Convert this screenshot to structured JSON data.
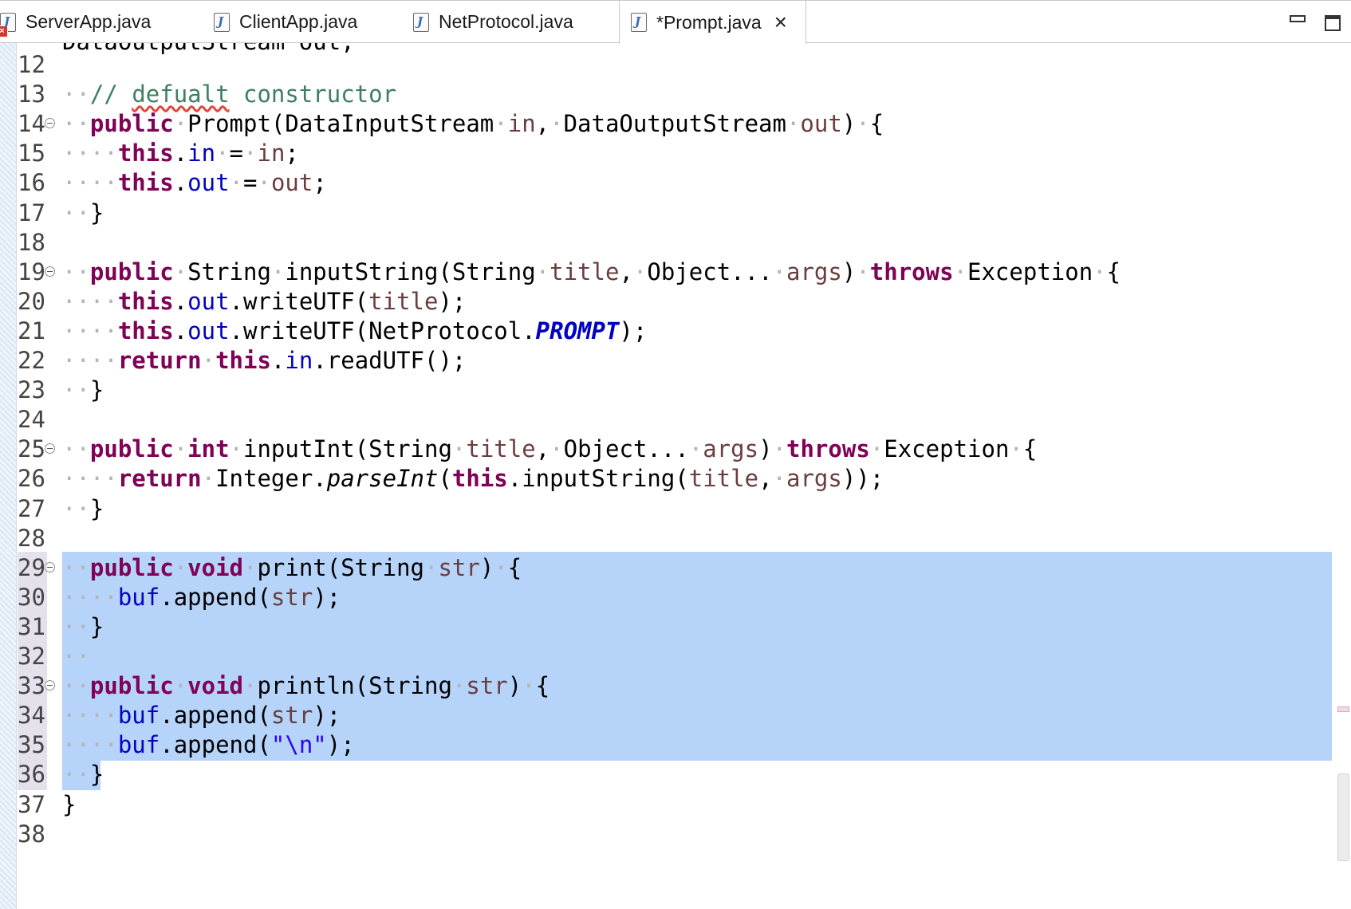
{
  "tabs": [
    {
      "label": "ServerApp.java",
      "icon": "java-file-icon",
      "has_error": true,
      "active": false
    },
    {
      "label": "ClientApp.java",
      "icon": "java-file-icon",
      "has_error": false,
      "active": false
    },
    {
      "label": "NetProtocol.java",
      "icon": "java-file-icon",
      "has_error": false,
      "active": false
    },
    {
      "label": "*Prompt.java",
      "icon": "java-file-icon",
      "has_error": false,
      "active": true
    }
  ],
  "window_controls": {
    "minimize_icon": "minimize-icon",
    "maximize_icon": "maximize-icon"
  },
  "colors": {
    "keyword": "#7f0055",
    "field": "#0000c0",
    "parameter": "#6a3e3e",
    "comment": "#3f7f5f",
    "string": "#2a00ff",
    "selection": "#b6d3fa"
  },
  "editor": {
    "partial_top_line": "DataOutputStream out;",
    "lines": [
      {
        "num": "12",
        "fold": false,
        "selected": false,
        "code": ""
      },
      {
        "num": "13",
        "fold": false,
        "selected": false,
        "code": "// defualt constructor"
      },
      {
        "num": "14",
        "fold": true,
        "selected": false,
        "code": "public Prompt(DataInputStream in, DataOutputStream out) {"
      },
      {
        "num": "15",
        "fold": false,
        "selected": false,
        "code": "this.in = in;"
      },
      {
        "num": "16",
        "fold": false,
        "selected": false,
        "code": "this.out = out;"
      },
      {
        "num": "17",
        "fold": false,
        "selected": false,
        "code": "}"
      },
      {
        "num": "18",
        "fold": false,
        "selected": false,
        "code": ""
      },
      {
        "num": "19",
        "fold": true,
        "selected": false,
        "code": "public String inputString(String title, Object... args) throws Exception {"
      },
      {
        "num": "20",
        "fold": false,
        "selected": false,
        "code": "this.out.writeUTF(title);"
      },
      {
        "num": "21",
        "fold": false,
        "selected": false,
        "code": "this.out.writeUTF(NetProtocol.PROMPT);"
      },
      {
        "num": "22",
        "fold": false,
        "selected": false,
        "code": "return this.in.readUTF();"
      },
      {
        "num": "23",
        "fold": false,
        "selected": false,
        "code": "}"
      },
      {
        "num": "24",
        "fold": false,
        "selected": false,
        "code": ""
      },
      {
        "num": "25",
        "fold": true,
        "selected": false,
        "code": "public int inputInt(String title, Object... args) throws Exception {"
      },
      {
        "num": "26",
        "fold": false,
        "selected": false,
        "code": "return Integer.parseInt(this.inputString(title, args));"
      },
      {
        "num": "27",
        "fold": false,
        "selected": false,
        "code": "}"
      },
      {
        "num": "28",
        "fold": false,
        "selected": false,
        "code": ""
      },
      {
        "num": "29",
        "fold": true,
        "selected": true,
        "code": "public void print(String str) {"
      },
      {
        "num": "30",
        "fold": false,
        "selected": true,
        "code": "buf.append(str);"
      },
      {
        "num": "31",
        "fold": false,
        "selected": true,
        "code": "}"
      },
      {
        "num": "32",
        "fold": false,
        "selected": true,
        "code": ""
      },
      {
        "num": "33",
        "fold": true,
        "selected": true,
        "code": "public void println(String str) {"
      },
      {
        "num": "34",
        "fold": false,
        "selected": true,
        "code": "buf.append(str);"
      },
      {
        "num": "35",
        "fold": false,
        "selected": true,
        "code": "buf.append(\"\\n\");"
      },
      {
        "num": "36",
        "fold": false,
        "selected": true,
        "code": "}"
      },
      {
        "num": "37",
        "fold": false,
        "selected": false,
        "code": "}"
      },
      {
        "num": "38",
        "fold": false,
        "selected": false,
        "code": ""
      }
    ]
  }
}
